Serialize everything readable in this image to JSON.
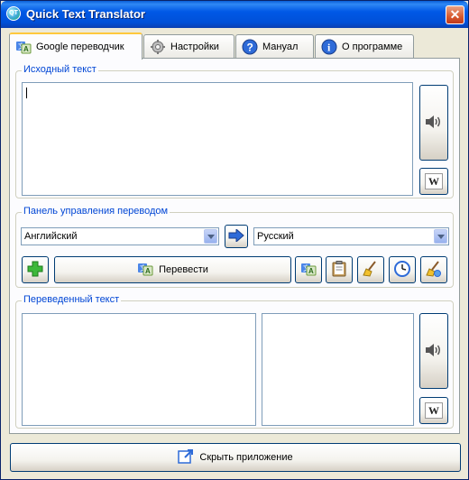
{
  "window": {
    "title": "Quick Text Translator",
    "close_glyph": "✕",
    "app_icon_text": "QT"
  },
  "tabs": [
    {
      "label": "Google переводчик",
      "icon": "translate-icon",
      "active": true
    },
    {
      "label": "Настройки",
      "icon": "gear-icon",
      "active": false
    },
    {
      "label": "Мануал",
      "icon": "help-icon",
      "active": false
    },
    {
      "label": "О программе",
      "icon": "info-icon",
      "active": false
    }
  ],
  "source": {
    "group_title": "Исходный текст",
    "text": "",
    "speak_icon": "speaker-icon",
    "wiki_label": "W"
  },
  "control": {
    "group_title": "Панель управления переводом",
    "from_language": "Английский",
    "to_language": "Русский",
    "translate_label": "Перевести",
    "tool_icons": [
      "add-icon",
      "translate-icon",
      "clipboard-icon",
      "broom-icon",
      "clock-icon",
      "clear-icon"
    ]
  },
  "result": {
    "group_title": "Переведенный текст",
    "text": "",
    "wiki_label": "W"
  },
  "footer": {
    "hide_label": "Скрыть приложение",
    "icon": "hide-window-icon"
  },
  "colors": {
    "title_bar": "#0058E6",
    "group_title": "#0046D5",
    "window_bg": "#ECE9D8",
    "active_tab_accent": "#FFC83C"
  }
}
